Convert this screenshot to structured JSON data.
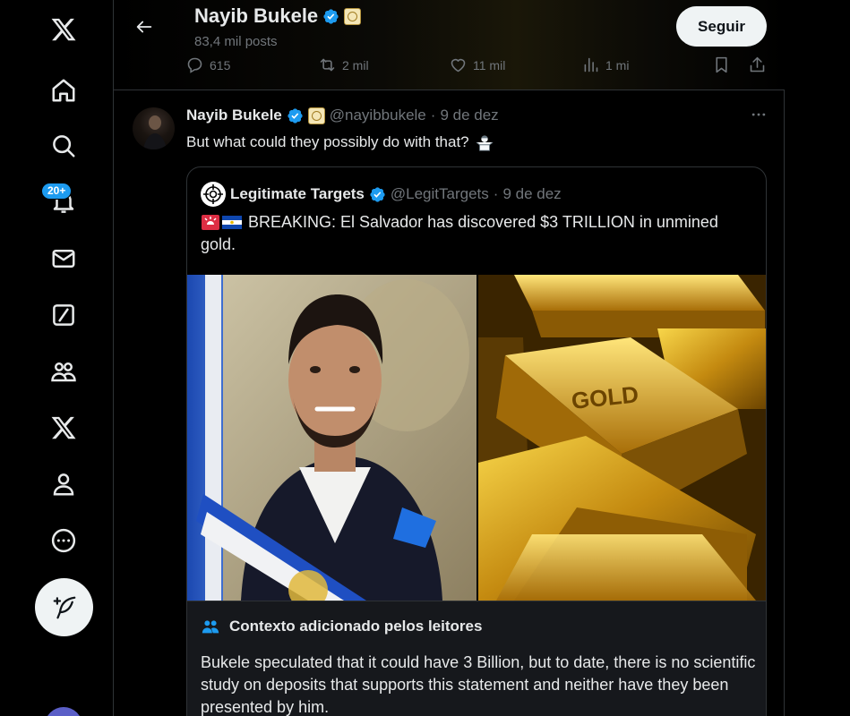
{
  "nav": {
    "items": [
      "X",
      "Home",
      "Explore",
      "Notifications",
      "Messages",
      "Grok",
      "Communities",
      "Premium",
      "Profile",
      "More"
    ],
    "notifications_badge": "20+",
    "post_button_label": "Post"
  },
  "header": {
    "name": "Nayib Bukele",
    "post_count": "83,4 mil posts",
    "follow_label": "Seguir",
    "actions": {
      "replies": "615",
      "reposts": "2 mil",
      "likes": "11 mil",
      "views": "1 mi"
    }
  },
  "tweet": {
    "author_name": "Nayib Bukele",
    "handle": "@nayibbukele",
    "separator": "·",
    "date": "9 de dez",
    "text": "But what could they possibly do with that?",
    "quote": {
      "author_name": "Legitimate Targets",
      "handle": "@LegitTargets",
      "separator": "·",
      "date": "9 de dez",
      "text": "BREAKING: El Salvador has discovered $3 TRILLION in unmined gold.",
      "images": [
        "portrait-photo",
        "gold-bars-photo"
      ],
      "gold_bar_text": "GOLD"
    },
    "context": {
      "title": "Contexto adicionado pelos leitores",
      "body": "Bukele speculated that it could have 3 Billion, but to date, there is no scientific study on deposits that supports this statement and neither have they been presented by him."
    }
  },
  "colors": {
    "accent": "#1d9bf0",
    "background": "#000000",
    "muted": "#71767b",
    "border": "#2f3336"
  }
}
